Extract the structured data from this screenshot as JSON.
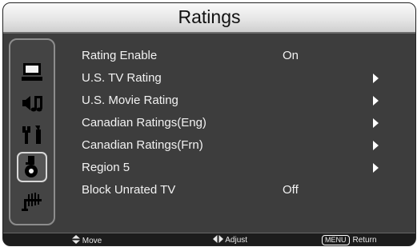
{
  "title": "Ratings",
  "sidebar": {
    "icons": [
      {
        "name": "screen-icon"
      },
      {
        "name": "audio-icon"
      },
      {
        "name": "tools-icon"
      },
      {
        "name": "lock-icon",
        "selected": true
      },
      {
        "name": "antenna-icon"
      }
    ]
  },
  "menu": {
    "items": [
      {
        "label": "Rating Enable",
        "value": "On"
      },
      {
        "label": "U.S. TV Rating",
        "submenu": true
      },
      {
        "label": "U.S. Movie Rating",
        "submenu": true
      },
      {
        "label": "Canadian Ratings(Eng)",
        "submenu": true
      },
      {
        "label": "Canadian Ratings(Frn)",
        "submenu": true
      },
      {
        "label": "Region 5",
        "submenu": true
      },
      {
        "label": "Block Unrated TV",
        "value": "Off"
      }
    ]
  },
  "footer": {
    "move_label": "Move",
    "adjust_label": "Adjust",
    "menu_key": "MENU",
    "return_label": "Return"
  }
}
